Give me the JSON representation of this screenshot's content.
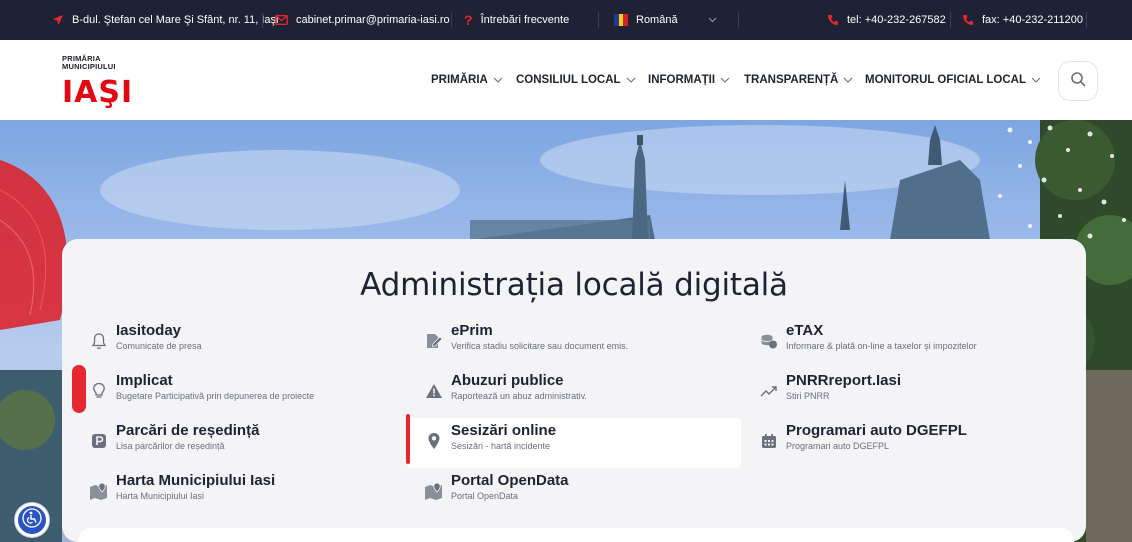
{
  "topbar": {
    "address": "B-dul. Ştefan cel Mare Şi Sfânt, nr. 11, Iaşi",
    "email": "cabinet.primar@primaria-iasi.ro",
    "faq": "Întrebări frecvente",
    "language": "Română",
    "phone": "tel: +40-232-267582",
    "fax": "fax: +40-232-211200"
  },
  "logo": {
    "line1": "PRIMĂRIA",
    "line2": "MUNICIPIULUI",
    "word": "IAŞI"
  },
  "nav": {
    "items": [
      {
        "label": "PRIMĂRIA"
      },
      {
        "label": "CONSILIUL LOCAL"
      },
      {
        "label": "INFORMAȚII"
      },
      {
        "label": "TRANSPARENȚĂ"
      },
      {
        "label": "MONITORUL OFICIAL LOCAL"
      }
    ]
  },
  "card": {
    "title": "Administrația locală digitală"
  },
  "services": [
    {
      "title": "Iasitoday",
      "subtitle": "Comunicate de presa",
      "icon": "bell-icon"
    },
    {
      "title": "ePrim",
      "subtitle": "Verifica stadiu solicitare sau document emis.",
      "icon": "document-edit-icon"
    },
    {
      "title": "eTAX",
      "subtitle": "Informare & plată on-line a taxelor și impozitelor",
      "icon": "coins-icon"
    },
    {
      "title": "Implicat",
      "subtitle": "Bugetare Participativă prin depunerea de proiecte",
      "icon": "lightbulb-icon"
    },
    {
      "title": "Abuzuri publice",
      "subtitle": "Raportează un abuz administrativ.",
      "icon": "warning-icon"
    },
    {
      "title": "PNRRreport.Iasi",
      "subtitle": "Stiri PNRR",
      "icon": "trend-up-icon"
    },
    {
      "title": "Parcări de reședință",
      "subtitle": "Lisa parcărilor de reședință",
      "icon": "parking-icon"
    },
    {
      "title": "Sesizări online",
      "subtitle": "Sesizări - hartă incidente",
      "icon": "map-pin-icon"
    },
    {
      "title": "Programari auto DGEFPL",
      "subtitle": "Programari auto DGEFPL",
      "icon": "calendar-icon"
    },
    {
      "title": "Harta Municipiului Iasi",
      "subtitle": "Harta Municipiului Iasi",
      "icon": "map-icon"
    },
    {
      "title": "Portal OpenData",
      "subtitle": "Portal OpenData",
      "icon": "map-icon"
    }
  ],
  "colors": {
    "accent": "#e8262f",
    "topbar": "#1f2234",
    "card": "#f4f4f6"
  }
}
